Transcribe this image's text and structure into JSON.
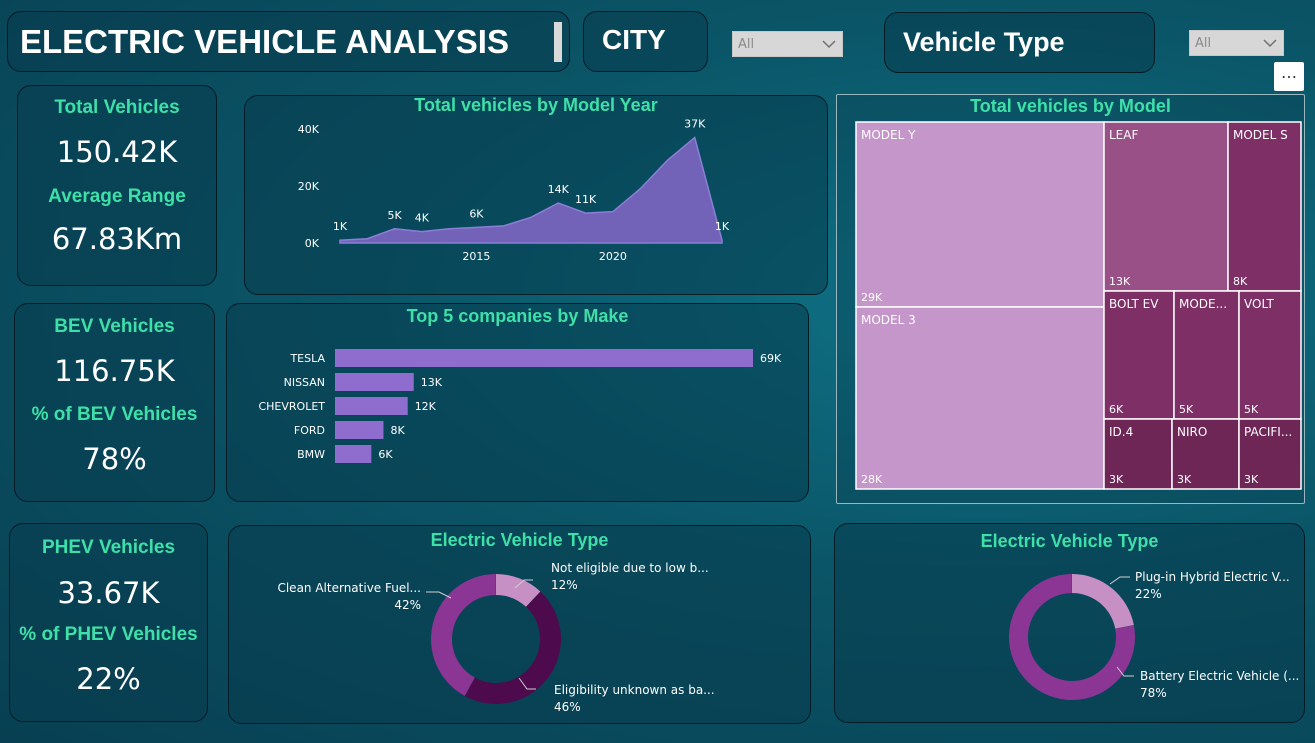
{
  "header": {
    "title": "ELECTRIC VEHICLE ANALYSIS"
  },
  "filters": {
    "city_label": "CITY",
    "city_value": "All",
    "vehicle_type_label": "Vehicle Type",
    "vehicle_type_value": "All"
  },
  "more_options": "…",
  "kpis": {
    "total_vehicles_label": "Total Vehicles",
    "total_vehicles_value": "150.42K",
    "average_range_label": "Average Range",
    "average_range_value": "67.83Km",
    "bev_label": "BEV Vehicles",
    "bev_value": "116.75K",
    "bev_pct_label": "% of BEV Vehicles",
    "bev_pct_value": "78%",
    "phev_label": "PHEV Vehicles",
    "phev_value": "33.67K",
    "phev_pct_label": "% of PHEV Vehicles",
    "phev_pct_value": "22%"
  },
  "colors": {
    "accent": "#3ee0a8",
    "area": "#7363b8",
    "bar": "#8e6dcf",
    "treemap_light": "#c596c9",
    "treemap_mid": "#995086",
    "treemap_dark": "#7e2f65",
    "treemap_darker": "#6e2657",
    "donut_dark": "#4d0b4d",
    "donut_mid": "#8b3594",
    "donut_light": "#c790c4"
  },
  "chart_data": [
    {
      "type": "area",
      "title": "Total vehicles by Model Year",
      "x_ticks": [
        "2015",
        "2020"
      ],
      "y_ticks": [
        "0K",
        "20K",
        "40K"
      ],
      "ylim": [
        0,
        40000
      ],
      "x": [
        2010,
        2011,
        2012,
        2013,
        2014,
        2015,
        2016,
        2017,
        2018,
        2019,
        2020,
        2021,
        2022,
        2023,
        2024
      ],
      "values": [
        1000,
        1500,
        5000,
        4000,
        5000,
        5500,
        6000,
        9000,
        14000,
        10500,
        11000,
        19000,
        29000,
        37000,
        1000
      ],
      "data_labels": [
        {
          "x": 2010,
          "text": "1K"
        },
        {
          "x": 2012,
          "text": "5K"
        },
        {
          "x": 2013,
          "text": "4K"
        },
        {
          "x": 2015,
          "text": "6K"
        },
        {
          "x": 2018,
          "text": "14K"
        },
        {
          "x": 2019,
          "text": "11K"
        },
        {
          "x": 2023,
          "text": "37K"
        },
        {
          "x": 2024,
          "text": "1K"
        }
      ]
    },
    {
      "type": "bar",
      "title": "Top 5 companies by Make",
      "categories": [
        "TESLA",
        "NISSAN",
        "CHEVROLET",
        "FORD",
        "BMW"
      ],
      "values": [
        69,
        13,
        12,
        8,
        6
      ],
      "labels": [
        "69K",
        "13K",
        "12K",
        "8K",
        "6K"
      ]
    },
    {
      "type": "treemap",
      "title": "Total vehicles by Model",
      "items": [
        {
          "name": "MODEL Y",
          "label": "29K"
        },
        {
          "name": "MODEL 3",
          "label": "28K"
        },
        {
          "name": "LEAF",
          "label": "13K"
        },
        {
          "name": "MODEL S",
          "label": "8K"
        },
        {
          "name": "BOLT EV",
          "label": "6K"
        },
        {
          "name": "MODE...",
          "label": "5K"
        },
        {
          "name": "VOLT",
          "label": "5K"
        },
        {
          "name": "ID.4",
          "label": "3K"
        },
        {
          "name": "NIRO",
          "label": "3K"
        },
        {
          "name": "PACIFI...",
          "label": "3K"
        }
      ]
    },
    {
      "type": "pie",
      "title": "Electric Vehicle Type",
      "slices": [
        {
          "name": "Not eligible due to low b...",
          "pct": 12,
          "label": "12%"
        },
        {
          "name": "Eligibility unknown as ba...",
          "pct": 46,
          "label": "46%"
        },
        {
          "name": "Clean Alternative Fuel...",
          "pct": 42,
          "label": "42%"
        }
      ]
    },
    {
      "type": "pie",
      "title": "Electric Vehicle Type",
      "slices": [
        {
          "name": "Plug-in Hybrid Electric V...",
          "pct": 22,
          "label": "22%"
        },
        {
          "name": "Battery Electric Vehicle (...",
          "pct": 78,
          "label": "78%"
        }
      ]
    }
  ]
}
